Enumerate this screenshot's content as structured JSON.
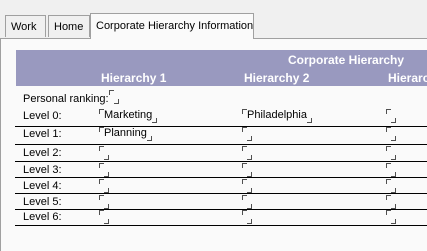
{
  "tabs": [
    {
      "label": "Work",
      "active": false
    },
    {
      "label": "Home",
      "active": false
    },
    {
      "label": "Corporate Hierarchy Information",
      "active": true
    }
  ],
  "header": {
    "title": "Corporate Hierarchy",
    "columns": [
      "Hierarchy 1",
      "Hierarchy 2",
      "Hierarc"
    ]
  },
  "personal_ranking": {
    "label": "Personal ranking:",
    "value": ""
  },
  "levels": [
    {
      "label": "Level 0:",
      "values": [
        "Marketing",
        "Philadelphia",
        ""
      ]
    },
    {
      "label": "Level 1:",
      "values": [
        "Planning",
        "",
        ""
      ]
    },
    {
      "label": "Level 2:",
      "values": [
        "",
        "",
        ""
      ]
    },
    {
      "label": "Level 3:",
      "values": [
        "",
        "",
        ""
      ]
    },
    {
      "label": "Level 4:",
      "values": [
        "",
        "",
        ""
      ]
    },
    {
      "label": "Level 5:",
      "values": [
        "",
        "",
        ""
      ]
    },
    {
      "label": "Level 6:",
      "values": [
        "",
        "",
        ""
      ]
    }
  ]
}
